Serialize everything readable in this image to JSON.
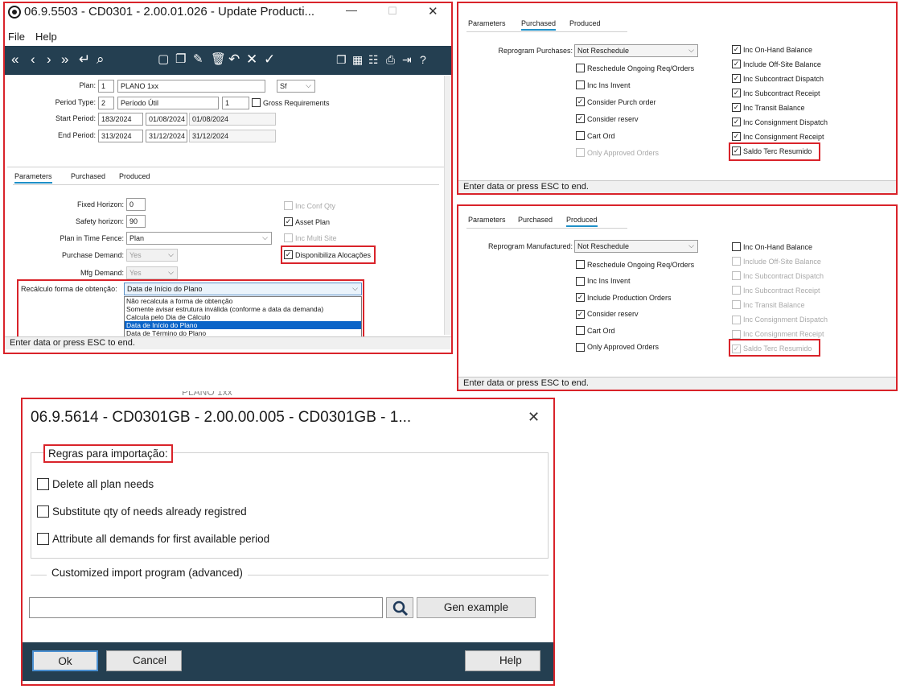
{
  "main_window": {
    "title": "06.9.5503 - CD0301 - 2.00.01.026 - Update Producti...",
    "menu": [
      "File",
      "Help"
    ],
    "form": {
      "plan_label": "Plan:",
      "plan_code": "1",
      "plan_name": "PLANO 1xx",
      "plan_site": "Sf",
      "period_type_label": "Period Type:",
      "period_type_code": "2",
      "period_type_name": "Período Útil",
      "period_type_value": "1",
      "gross_requirements_label": "Gross Requirements",
      "gross_requirements_checked": false,
      "start_period_label": "Start Period:",
      "start_period_code": "183/2024",
      "start_period_date1": "01/08/2024",
      "start_period_date2": "01/08/2024",
      "end_period_label": "End Period:",
      "end_period_code": "313/2024",
      "end_period_date1": "31/12/2024",
      "end_period_date2": "31/12/2024"
    },
    "tabs": [
      "Parameters",
      "Purchased",
      "Produced"
    ],
    "active_tab": "Parameters",
    "parameters": {
      "fixed_horizon_label": "Fixed Horizon:",
      "fixed_horizon": "0",
      "safety_horizon_label": "Safety horizon:",
      "safety_horizon": "90",
      "plan_in_time_fence_label": "Plan in Time Fence:",
      "plan_in_time_fence": "Plan",
      "purchase_demand_label": "Purchase Demand:",
      "purchase_demand": "Yes",
      "mfg_demand_label": "Mfg Demand:",
      "mfg_demand": "Yes",
      "inc_conf_qty_label": "Inc Conf Qty",
      "inc_conf_qty": false,
      "asset_plan_label": "Asset Plan",
      "asset_plan": true,
      "inc_multi_site_label": "Inc Multi Site",
      "inc_multi_site": false,
      "disponibiliza_label": "Disponibiliza Alocações",
      "disponibiliza": true,
      "recalculo_label": "Recálculo forma de obtenção:",
      "recalculo_selected": "Data de Início do Plano",
      "recalculo_options": [
        "Não recalcula a forma de obtenção",
        "Somente avisar estrutura inválida (conforme a data da demanda)",
        "Calcula pelo Dia de Cálculo",
        "Data de Início do Plano",
        "Data de Término do Plano"
      ],
      "recalculo_selected_index": 3
    },
    "status": "Enter data or press ESC to end."
  },
  "purchased_panel": {
    "tabs": [
      "Parameters",
      "Purchased",
      "Produced"
    ],
    "active_tab": "Purchased",
    "reprogram_label": "Reprogram Purchases:",
    "reprogram_value": "Not Reschedule",
    "left_checks": [
      {
        "label": "Reschedule Ongoing Req/Orders",
        "checked": false,
        "disabled": false
      },
      {
        "label": "Inc Ins Invent",
        "checked": false,
        "disabled": false
      },
      {
        "label": "Consider Purch order",
        "checked": true,
        "disabled": false
      },
      {
        "label": "Consider reserv",
        "checked": true,
        "disabled": false
      },
      {
        "label": "Cart Ord",
        "checked": false,
        "disabled": false
      },
      {
        "label": "Only Approved Orders",
        "checked": false,
        "disabled": true
      }
    ],
    "right_checks": [
      {
        "label": "Inc On-Hand Balance",
        "checked": true,
        "disabled": false
      },
      {
        "label": "Include Off-Site Balance",
        "checked": true,
        "disabled": false
      },
      {
        "label": "Inc Subcontract Dispatch",
        "checked": true,
        "disabled": false
      },
      {
        "label": "Inc Subcontract Receipt",
        "checked": true,
        "disabled": false
      },
      {
        "label": "Inc Transit Balance",
        "checked": true,
        "disabled": false
      },
      {
        "label": "Inc Consignment Dispatch",
        "checked": true,
        "disabled": false
      },
      {
        "label": "Inc Consignment Receipt",
        "checked": true,
        "disabled": false
      },
      {
        "label": "Saldo Terc Resumido",
        "checked": true,
        "disabled": false
      }
    ],
    "status": "Enter data or press ESC to end."
  },
  "produced_panel": {
    "tabs": [
      "Parameters",
      "Purchased",
      "Produced"
    ],
    "active_tab": "Produced",
    "reprogram_label": "Reprogram Manufactured:",
    "reprogram_value": "Not Reschedule",
    "left_checks": [
      {
        "label": "Reschedule Ongoing Req/Orders",
        "checked": false,
        "disabled": false
      },
      {
        "label": "Inc Ins Invent",
        "checked": false,
        "disabled": false
      },
      {
        "label": "Include Production Orders",
        "checked": true,
        "disabled": false
      },
      {
        "label": "Consider reserv",
        "checked": true,
        "disabled": false
      },
      {
        "label": "Cart Ord",
        "checked": false,
        "disabled": false
      },
      {
        "label": "Only Approved Orders",
        "checked": false,
        "disabled": false
      }
    ],
    "right_checks": [
      {
        "label": "Inc On-Hand Balance",
        "checked": false,
        "disabled": false
      },
      {
        "label": "Include Off-Site Balance",
        "checked": false,
        "disabled": true
      },
      {
        "label": "Inc Subcontract Dispatch",
        "checked": false,
        "disabled": true
      },
      {
        "label": "Inc Subcontract Receipt",
        "checked": false,
        "disabled": true
      },
      {
        "label": "Inc Transit Balance",
        "checked": false,
        "disabled": true
      },
      {
        "label": "Inc Consignment Dispatch",
        "checked": false,
        "disabled": true
      },
      {
        "label": "Inc Consignment Receipt",
        "checked": false,
        "disabled": true
      },
      {
        "label": "Saldo Terc Resumido",
        "checked": true,
        "disabled": true
      }
    ],
    "status": "Enter data or press ESC to end."
  },
  "import_dialog": {
    "background_fragment": "PLANO 1xx",
    "title": "06.9.5614 - CD0301GB - 2.00.00.005 - CD0301GB - 1...",
    "rules_group_label": "Regras para importação:",
    "checks": [
      {
        "label": "Delete all plan needs",
        "checked": false
      },
      {
        "label": "Substitute qty of needs already registred",
        "checked": false
      },
      {
        "label": "Attribute all demands for first available period",
        "checked": false
      }
    ],
    "custom_group_label": "Customized import program (advanced)",
    "program_path": "",
    "gen_example_label": "Gen example",
    "ok_label": "Ok",
    "cancel_label": "Cancel",
    "help_label": "Help"
  },
  "icons": {
    "check_mark": "✓",
    "dropdown_arrow": "⌵",
    "close": "✕",
    "minimize": "—",
    "maximize": "☐"
  },
  "colors": {
    "highlight_red": "#d9232a",
    "toolbar_dark": "#243f51",
    "selection_blue": "#0a64c8",
    "tab_underline": "#1e90c8"
  }
}
